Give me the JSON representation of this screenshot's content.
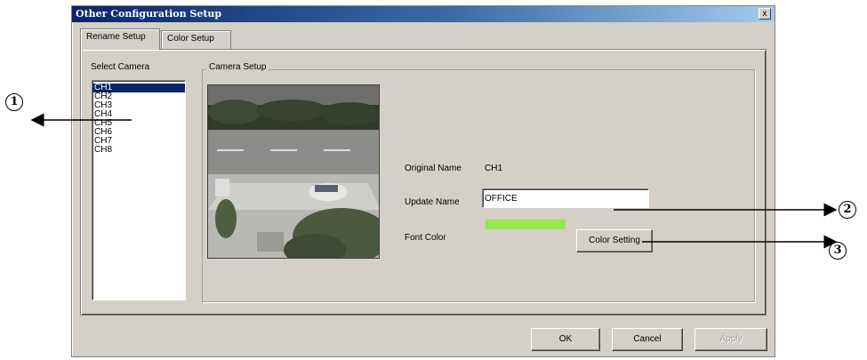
{
  "window": {
    "title": "Other Configuration Setup",
    "close_glyph": "x"
  },
  "tabs": [
    {
      "label": "Rename Setup",
      "active": true
    },
    {
      "label": "Color Setup",
      "active": false
    }
  ],
  "select_camera": {
    "label": "Select Camera",
    "items": [
      "CH1",
      "CH2",
      "CH3",
      "CH4",
      "CH5",
      "CH6",
      "CH7",
      "CH8"
    ],
    "selected": "CH1"
  },
  "camera_setup": {
    "group_label": "Camera Setup",
    "original_name_label": "Original Name",
    "original_name_value": "CH1",
    "update_name_label": "Update Name",
    "update_name_value": "OFFICE",
    "font_color_label": "Font Color",
    "font_color_hex": "#99e64d",
    "color_setting_button": "Color Setting"
  },
  "buttons": {
    "ok": "OK",
    "cancel": "Cancel",
    "apply": "Apply"
  },
  "annotations": [
    "1",
    "2",
    "3"
  ],
  "colors": {
    "dialog_bg": "#d4d0c8",
    "titlebar": "#0a246a",
    "selection": "#0a246a"
  }
}
